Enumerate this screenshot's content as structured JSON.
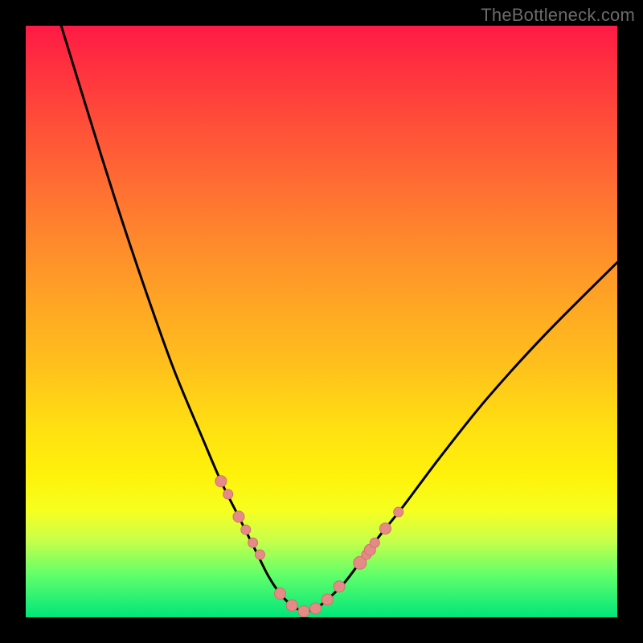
{
  "watermark": "TheBottleneck.com",
  "colors": {
    "frame": "#000000",
    "curve": "#000000",
    "marker_fill": "#e58b87",
    "marker_stroke": "#d46f6b",
    "gradient_stops": [
      {
        "pct": 0,
        "hex": "#ff1a45"
      },
      {
        "pct": 10,
        "hex": "#ff3a3d"
      },
      {
        "pct": 22,
        "hex": "#ff5f36"
      },
      {
        "pct": 34,
        "hex": "#ff822e"
      },
      {
        "pct": 46,
        "hex": "#ffa325"
      },
      {
        "pct": 58,
        "hex": "#ffc21c"
      },
      {
        "pct": 68,
        "hex": "#ffe012"
      },
      {
        "pct": 76,
        "hex": "#fff20b"
      },
      {
        "pct": 82,
        "hex": "#f6ff20"
      },
      {
        "pct": 87,
        "hex": "#c8ff4a"
      },
      {
        "pct": 93,
        "hex": "#5eff6a"
      },
      {
        "pct": 100,
        "hex": "#00e67a"
      }
    ]
  },
  "chart_data": {
    "type": "line",
    "title": "",
    "xlabel": "",
    "ylabel": "",
    "xlim": [
      0,
      100
    ],
    "ylim": [
      0,
      100
    ],
    "note": "Axes are implicit (0–100). Y is a V-shaped bottleneck curve: high = bad (red), near 0 = good (green). Minimum occurs around x≈47. Left branch is steeper than right. Markers cluster around the trough and on both arms of the V.",
    "series": [
      {
        "name": "bottleneck-curve",
        "x": [
          6,
          10,
          15,
          20,
          25,
          30,
          33,
          36,
          39,
          41,
          43,
          45,
          47,
          49,
          51,
          54,
          57,
          60,
          64,
          70,
          78,
          88,
          100
        ],
        "y": [
          100,
          87,
          71,
          56,
          42,
          30,
          23,
          17,
          11,
          7,
          4,
          2,
          1,
          1.5,
          3,
          6,
          10,
          14,
          19,
          27,
          37,
          48,
          60
        ]
      }
    ],
    "markers": {
      "name": "sample-points",
      "x": [
        33.0,
        34.2,
        36.0,
        37.2,
        38.4,
        39.6,
        43.0,
        45.0,
        47.0,
        49.0,
        51.0,
        53.0,
        56.5,
        57.6,
        58.2,
        59.0,
        60.8,
        63.0
      ],
      "y": [
        23.0,
        20.8,
        17.0,
        14.8,
        12.6,
        10.6,
        4.0,
        2.0,
        1.0,
        1.5,
        3.0,
        5.2,
        9.2,
        10.6,
        11.4,
        12.6,
        15.0,
        17.8
      ],
      "r": [
        7,
        6,
        7,
        6,
        6,
        6,
        7,
        7,
        7,
        7,
        7,
        7,
        8,
        6,
        7,
        6,
        7,
        6
      ]
    }
  }
}
